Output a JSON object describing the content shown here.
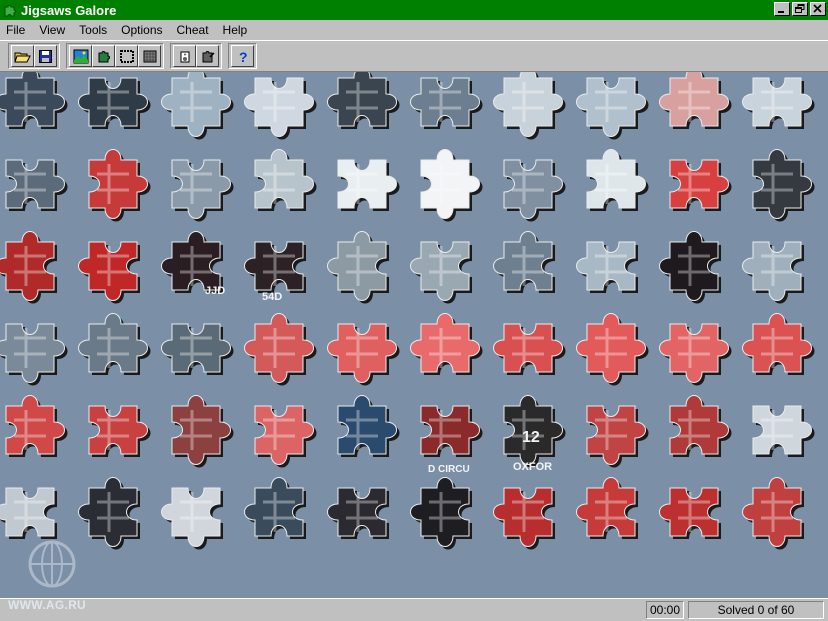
{
  "window": {
    "title": "Jigsaws Galore"
  },
  "menu": [
    "File",
    "View",
    "Tools",
    "Options",
    "Cheat",
    "Help"
  ],
  "toolbar": {
    "groups": [
      [
        "open-folder-icon",
        "save-disk-icon"
      ],
      [
        "picture-icon",
        "pieces-icon",
        "frame-icon",
        "grid-icon"
      ],
      [
        "sound-icon",
        "hint-icon"
      ],
      [
        "help-question-icon"
      ]
    ]
  },
  "puzzle": {
    "piece_count": 60,
    "rows": 6,
    "columns": 10,
    "piece_colors": [
      [
        "#3b4a5a",
        "#2f3c48",
        "#9fb2c2",
        "#cfd8e0",
        "#3a4550",
        "#6c7e8f",
        "#c8d2da",
        "#b0c0cc",
        "#d9a0a0",
        "#c9d3db"
      ],
      [
        "#5b6b7a",
        "#c63a3a",
        "#8a9aa8",
        "#b8c4cc",
        "#e9eef1",
        "#f2f4f5",
        "#8090a0",
        "#dfe6ea",
        "#d84040",
        "#343a40"
      ],
      [
        "#b02a2a",
        "#c02828",
        "#2a1e22",
        "#2c2226",
        "#8c9aa4",
        "#9aa8b2",
        "#6e8090",
        "#a8b8c4",
        "#1e1a1e",
        "#9fb0bc"
      ],
      [
        "#7a8a98",
        "#6a7a88",
        "#5a6a76",
        "#d45a5a",
        "#e06060",
        "#e86a6a",
        "#d85050",
        "#e25a5a",
        "#e26464",
        "#da5252"
      ],
      [
        "#d04848",
        "#c84040",
        "#8c4040",
        "#dc6464",
        "#2a4a6e",
        "#8a2a2a",
        "#2a2a2a",
        "#c04444",
        "#b03a3a",
        "#cfd6dc"
      ],
      [
        "#c0c8d0",
        "#2a2e34",
        "#d0d6dc",
        "#3a4c5c",
        "#2a2a30",
        "#1e1e22",
        "#b82e2e",
        "#c63a3a",
        "#bc3030",
        "#c04040"
      ]
    ]
  },
  "piece_labels": [
    "JJD",
    "54D",
    "12",
    "OXFOR",
    "D CIRCU"
  ],
  "watermark": "WWW.AG.RU",
  "status": {
    "timer": "00:00",
    "solved": "Solved 0 of 60"
  },
  "colors": {
    "titlebar": "#008000",
    "playarea": "#7b8fa6",
    "chrome": "#c0c0c0"
  }
}
